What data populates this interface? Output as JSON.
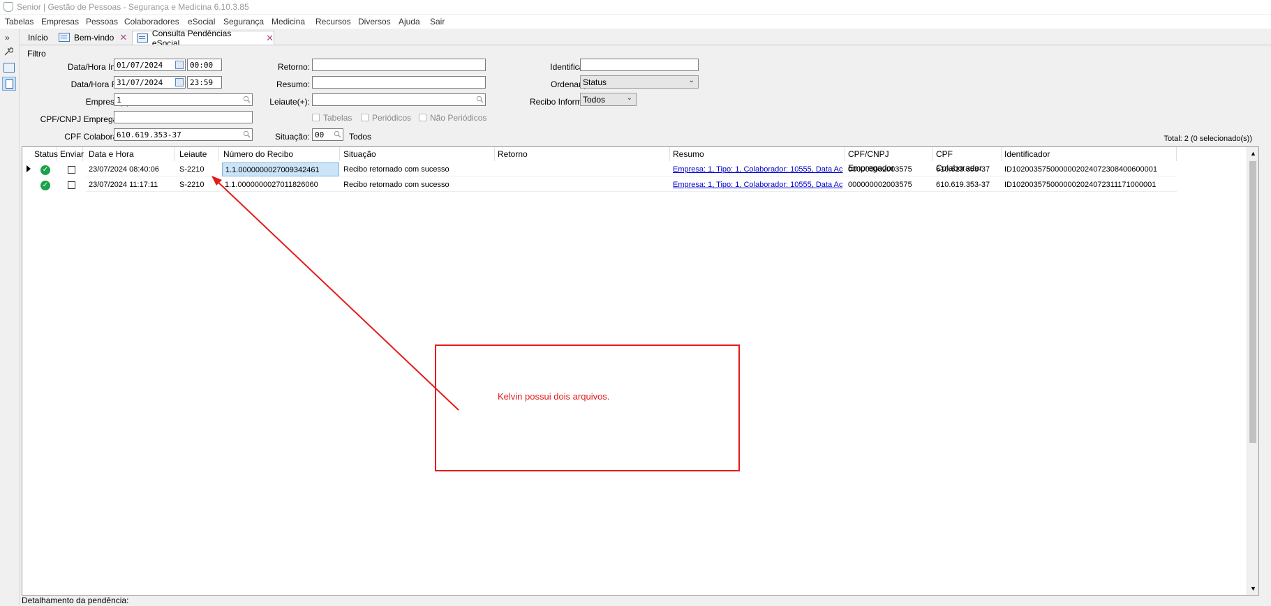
{
  "window": {
    "title": "Senior | Gestão de Pessoas - Segurança e Medicina 6.10.3.85"
  },
  "menu": [
    "Tabelas",
    "Empresas",
    "Pessoas",
    "Colaboradores",
    "eSocial",
    "Segurança",
    "Medicina",
    "Recursos",
    "Diversos",
    "Ajuda",
    "Sair"
  ],
  "tabs": {
    "inicio": "Início",
    "bemvindo": "Bem-vindo",
    "consulta": "Consulta Pendências eSocial"
  },
  "filter": {
    "group_label": "Filtro",
    "data_hora_inicial_label": "Data/Hora Inicial:",
    "data_inicial": "01/07/2024",
    "hora_inicial": "00:00",
    "data_hora_final_label": "Data/Hora Final:",
    "data_final": "31/07/2024",
    "hora_final": "23:59",
    "empresa_label": "Empresa(+):",
    "empresa": "1",
    "cpf_cnpj_label": "CPF/CNPJ Empregador:",
    "cpf_cnpj": "",
    "cpf_colab_label": "CPF Colaborador:",
    "cpf_colab": "610.619.353-37",
    "retorno_label": "Retorno:",
    "retorno": "",
    "resumo_label": "Resumo:",
    "resumo": "",
    "leiaute_label": "Leiaute(+):",
    "leiaute": "",
    "tabelas_label": "Tabelas",
    "periodicos_label": "Periódicos",
    "nao_periodicos_label": "Não Periódicos",
    "situacao_label": "Situação:",
    "situacao": "00",
    "situacao_desc": "Todos",
    "identificador_label": "Identificador:",
    "identificador": "",
    "ordenar_label": "Ordenar por:",
    "ordenar": "Status",
    "recibo_label": "Recibo Informado:",
    "recibo": "Todos",
    "total": "Total: 2 (0 selecionado(s))"
  },
  "grid": {
    "headers": [
      "Status",
      "Enviar",
      "Data e Hora",
      "Leiaute",
      "Número do Recibo",
      "Situação",
      "Retorno",
      "Resumo",
      "CPF/CNPJ Empregador",
      "CPF Colaborador",
      "Identificador"
    ],
    "rows": [
      {
        "data_hora": "23/07/2024 08:40:06",
        "leiaute": "S-2210",
        "recibo": "1.1.0000000027009342461",
        "situacao": "Recibo retornado com sucesso",
        "retorno": "",
        "resumo": "Empresa: 1, Tipo: 1, Colaborador: 10555, Data Ac",
        "cpf_cnpj": "000000002003575",
        "cpf_colab": "610.619.353-37",
        "identificador": "ID1020035750000002024072308400600001"
      },
      {
        "data_hora": "23/07/2024 11:17:11",
        "leiaute": "S-2210",
        "recibo": "1.1.0000000027011826060",
        "situacao": "Recibo retornado com sucesso",
        "retorno": "",
        "resumo": "Empresa: 1, Tipo: 1, Colaborador: 10555, Data Ac",
        "cpf_cnpj": "000000002003575",
        "cpf_colab": "610.619.353-37",
        "identificador": "ID1020035750000002024072311171000001"
      }
    ]
  },
  "annotation": {
    "text": "Kelvin possui dois arquivos.",
    "color": "#e31b1b"
  },
  "footer": {
    "label": "Detalhamento da pendência:"
  }
}
